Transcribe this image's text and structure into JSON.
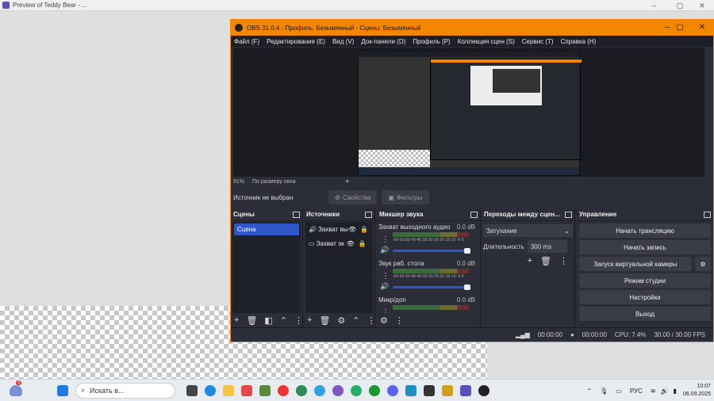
{
  "background_window": {
    "title": "Preview of Teddy Bear - ...",
    "controls": [
      "–",
      "▢",
      "✕"
    ]
  },
  "obs": {
    "title": "OBS 31.0.4 - Профиль: Безымянный - Сцены: Безымянный",
    "title_controls": [
      "–",
      "▢",
      "✕"
    ],
    "menu": [
      "Файл (F)",
      "Редактирование (E)",
      "Вид (V)",
      "Док-панели (D)",
      "Профиль (P)",
      "Коллекция сцен (S)",
      "Сервис (T)",
      "Справка (H)"
    ],
    "zoom": {
      "percent": "91%",
      "mode": "По размеру окна"
    },
    "source_bar": {
      "status": "Источник не выбран",
      "properties": "Свойства",
      "filters": "Фильтры"
    },
    "scenes": {
      "title": "Сцены",
      "items": [
        "Сцена"
      ]
    },
    "sources": {
      "title": "Источники",
      "items": [
        "Захват вы",
        "Захват эк"
      ]
    },
    "mixer": {
      "title": "Микшер звука",
      "channels": [
        {
          "name": "Захват выходного аудио",
          "db": "0.0 dB",
          "level": 0.98
        },
        {
          "name": "Звук раб. стола",
          "db": "0.0 dB",
          "level": 0.98
        },
        {
          "name": "Микр/доп",
          "db": "0.0 dB",
          "level": 0.98
        }
      ],
      "ticks": "-60-55-50-45-40-35-30-25-20-15-10 -5 0"
    },
    "transitions": {
      "title": "Переходы между сцен...",
      "selected": "Затухание",
      "duration_label": "Длительность",
      "duration_value": "300 ms"
    },
    "controls": {
      "title": "Управление",
      "buttons": [
        "Начать трансляцию",
        "Начать запись",
        "Запуск виртуальной камеры",
        "Режим студии",
        "Настройки",
        "Выход"
      ]
    },
    "status": {
      "stream_time": "00:00:00",
      "rec_time": "00:00:00",
      "cpu": "CPU: 7.4%",
      "fps": "30.00 / 30.00 FPS"
    }
  },
  "taskbar": {
    "search_placeholder": "Искать в...",
    "notification_count": "3",
    "lang": "РУС",
    "time": "10:07",
    "date": "06.09.2025"
  }
}
